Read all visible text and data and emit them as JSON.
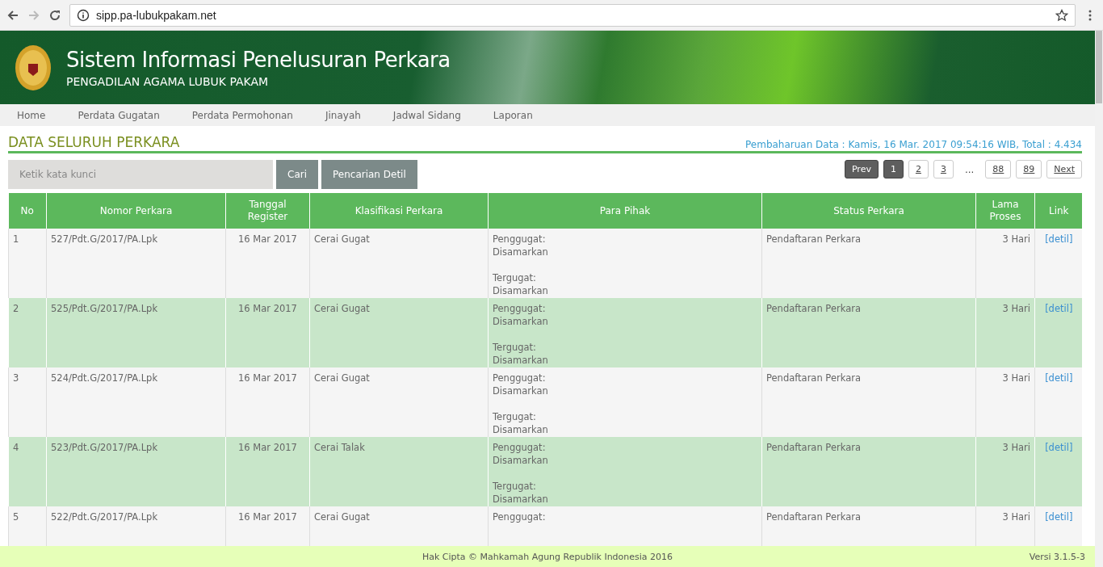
{
  "browser": {
    "url": "sipp.pa-lubukpakam.net"
  },
  "header": {
    "title": "Sistem Informasi Penelusuran Perkara",
    "subtitle": "PENGADILAN AGAMA LUBUK PAKAM"
  },
  "nav": [
    "Home",
    "Perdata Gugatan",
    "Perdata Permohonan",
    "Jinayah",
    "Jadwal Sidang",
    "Laporan"
  ],
  "page": {
    "title": "DATA SELURUH PERKARA",
    "update_info": "Pembaharuan Data : Kamis, 16 Mar. 2017 09:54:16 WIB, Total : 4.434"
  },
  "search": {
    "placeholder": "Ketik kata kunci",
    "buttons": [
      "Cari",
      "Pencarian Detil"
    ]
  },
  "pagination": [
    {
      "label": "Prev",
      "kind": "nav"
    },
    {
      "label": "1",
      "kind": "page",
      "selected": true
    },
    {
      "label": "2",
      "kind": "page",
      "selected": false
    },
    {
      "label": "3",
      "kind": "page",
      "selected": false
    },
    {
      "label": "...",
      "kind": "gap"
    },
    {
      "label": "88",
      "kind": "page",
      "selected": false
    },
    {
      "label": "89",
      "kind": "page",
      "selected": false
    },
    {
      "label": "Next",
      "kind": "link"
    }
  ],
  "table": {
    "columns": [
      "No",
      "Nomor Perkara",
      "Tanggal Register",
      "Klasifikasi Perkara",
      "Para Pihak",
      "Status Perkara",
      "Lama Proses",
      "Link"
    ],
    "rows": [
      {
        "no": "1",
        "nomor": "527/Pdt.G/2017/PA.Lpk",
        "tanggal": "16 Mar 2017",
        "klasifikasi": "Cerai Gugat",
        "pihak": [
          [
            "Penggugat:",
            "Disamarkan"
          ],
          [
            "Tergugat:",
            "Disamarkan"
          ]
        ],
        "status": "Pendaftaran Perkara",
        "lama": "3 Hari",
        "link": "[detil]"
      },
      {
        "no": "2",
        "nomor": "525/Pdt.G/2017/PA.Lpk",
        "tanggal": "16 Mar 2017",
        "klasifikasi": "Cerai Gugat",
        "pihak": [
          [
            "Penggugat:",
            "Disamarkan"
          ],
          [
            "Tergugat:",
            "Disamarkan"
          ]
        ],
        "status": "Pendaftaran Perkara",
        "lama": "3 Hari",
        "link": "[detil]"
      },
      {
        "no": "3",
        "nomor": "524/Pdt.G/2017/PA.Lpk",
        "tanggal": "16 Mar 2017",
        "klasifikasi": "Cerai Gugat",
        "pihak": [
          [
            "Penggugat:",
            "Disamarkan"
          ],
          [
            "Tergugat:",
            "Disamarkan"
          ]
        ],
        "status": "Pendaftaran Perkara",
        "lama": "3 Hari",
        "link": "[detil]"
      },
      {
        "no": "4",
        "nomor": "523/Pdt.G/2017/PA.Lpk",
        "tanggal": "16 Mar 2017",
        "klasifikasi": "Cerai Talak",
        "pihak": [
          [
            "Penggugat:",
            "Disamarkan"
          ],
          [
            "Tergugat:",
            "Disamarkan"
          ]
        ],
        "status": "Pendaftaran Perkara",
        "lama": "3 Hari",
        "link": "[detil]"
      },
      {
        "no": "5",
        "nomor": "522/Pdt.G/2017/PA.Lpk",
        "tanggal": "16 Mar 2017",
        "klasifikasi": "Cerai Gugat",
        "pihak": [
          [
            "Penggugat:"
          ]
        ],
        "status": "Pendaftaran Perkara",
        "lama": "3 Hari",
        "link": "[detil]"
      }
    ]
  },
  "footer": {
    "copyright": "Hak Cipta © Mahkamah Agung Republik Indonesia 2016",
    "version": "Versi 3.1.5-3"
  }
}
